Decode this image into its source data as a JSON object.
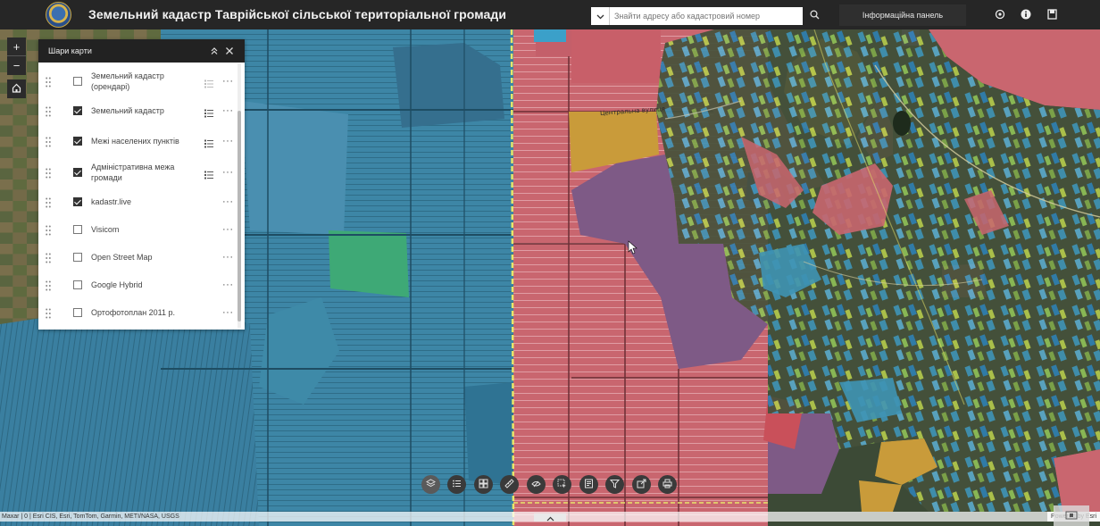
{
  "header": {
    "title": "Земельний кадастр Таврійської сільської територіальної громади",
    "search_placeholder": "Знайти адресу або кадастровий номер",
    "info_panel_label": "Інформаційна панель",
    "icons": [
      "emblem-logo",
      "chevron-down-icon",
      "search-icon",
      "location-icon",
      "info-icon",
      "bookmark-icon"
    ]
  },
  "map_controls": {
    "zoom_in": "+",
    "zoom_out": "−",
    "home_icon": "home-icon"
  },
  "layers_panel": {
    "title": "Шари карти",
    "icons": [
      "collapse-up-icon",
      "close-icon"
    ],
    "items": [
      {
        "label": "Земельний кадастр (орендарі)",
        "checked": false,
        "legend": true
      },
      {
        "label": "Земельний кадастр",
        "checked": true,
        "legend": true
      },
      {
        "label": "Межі населених пунктів",
        "checked": true,
        "legend": true
      },
      {
        "label": "Адміністративна межа громади",
        "checked": true,
        "legend": true
      },
      {
        "label": "kadastr.live",
        "checked": true,
        "legend": false
      },
      {
        "label": "Visicom",
        "checked": false,
        "legend": false
      },
      {
        "label": "Open Street Map",
        "checked": false,
        "legend": false
      },
      {
        "label": "Google Hybrid",
        "checked": false,
        "legend": false
      },
      {
        "label": "Ортофотоплан 2011 р.",
        "checked": false,
        "legend": false
      }
    ],
    "more_label": "···"
  },
  "toolbar": {
    "tools": [
      "layers-icon",
      "legend-list-icon",
      "basemap-gallery-icon",
      "measure-icon",
      "sketch-icon",
      "select-icon",
      "print-preview-icon",
      "filter-icon",
      "share-icon",
      "print-icon"
    ]
  },
  "map_labels": [
    "Центральна вулиця"
  ],
  "attribution": {
    "left": "Maxar | 0 | Esri CIS, Esri, TomTom, Garmin, METI/NASA, USGS",
    "right": "Powered by Esri"
  },
  "colors": {
    "parcel_blue": "#3f87a8",
    "parcel_pink": "#c9666f",
    "parcel_purple": "#7e5a86",
    "parcel_yellow": "#c99b3a",
    "parcel_green": "#4fb87a",
    "boundary_yellow": "#e8e66a",
    "header_bg": "#262626"
  }
}
